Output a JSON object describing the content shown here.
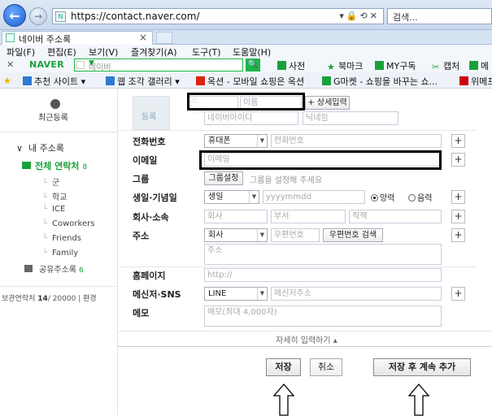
{
  "browser": {
    "url": "https://contact.naver.com/",
    "search_placeholder": "검색...",
    "tab_title": "네이버 주소록"
  },
  "menu": [
    "파일(F)",
    "편집(E)",
    "보기(V)",
    "즐겨찾기(A)",
    "도구(T)",
    "도움말(H)"
  ],
  "naver_toolbar": {
    "logo": "NAVER",
    "search_placeholder": "네이버",
    "tools": [
      "사전",
      "북마크",
      "MY구독",
      "캡처",
      "메"
    ]
  },
  "favorites": [
    "추천 사이트 ▾",
    "웹 조각 갤러리 ▾",
    "옥션 - 모바일 쇼핑은 옥션",
    "G마켓 - 쇼핑을 바꾸는 쇼...",
    "위메프"
  ],
  "sidebar": {
    "recent": "최근등록",
    "my_contacts": "내 주소록",
    "all_contacts": "전체 연락처",
    "all_count": "8",
    "groups": [
      "군",
      "학교",
      "ICE",
      "Coworkers",
      "Friends",
      "Family"
    ],
    "shared": "공유주소록",
    "shared_count": "6",
    "storage_label": "보관연락처",
    "storage_used": "14",
    "storage_total": "/ 20000",
    "storage_more": "| 환경"
  },
  "form": {
    "photo_label": "등록",
    "name_placeholder": "이름",
    "detail_button": "+ 상세입력",
    "naver_id_placeholder": "네이버아이디",
    "nickname_placeholder": "닉네임",
    "phone": {
      "label": "전화번호",
      "type": "휴대폰",
      "placeholder": "전화번호"
    },
    "email": {
      "label": "이메일",
      "placeholder": "이메일"
    },
    "group": {
      "label": "그룹",
      "button": "그룹설정",
      "hint": "그룹을 설정해 주세요"
    },
    "birthday": {
      "label": "생일·기념일",
      "type": "생일",
      "placeholder": "yyyymmdd",
      "solar": "양력",
      "lunar": "음력"
    },
    "company": {
      "label": "회사·소속",
      "company_ph": "회사",
      "dept_ph": "부서",
      "title_ph": "직책"
    },
    "address": {
      "label": "주소",
      "type": "회사",
      "zip_ph": "우편번호",
      "zip_button": "우편번호 검색",
      "addr_ph": "주소"
    },
    "homepage": {
      "label": "홈페이지",
      "placeholder": "http://"
    },
    "messenger": {
      "label": "메신저·SNS",
      "type": "LINE",
      "placeholder": "메신저주소"
    },
    "memo": {
      "label": "메모",
      "placeholder": "메모(최대 4,000자)"
    },
    "more_input": "자세히 입력하기 ▴",
    "save": "저장",
    "cancel": "취소",
    "save_and_add": "저장 후 계속 추가",
    "plus": "+"
  }
}
